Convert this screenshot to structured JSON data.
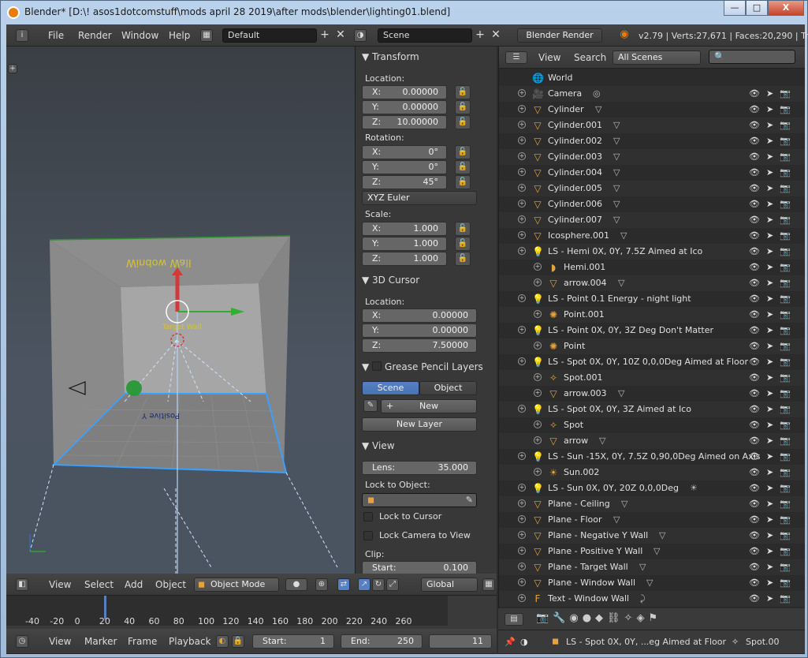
{
  "window": {
    "title": "Blender* [D:\\! asos1dotcomstuff\\mods april 28 2019\\after mods\\blender\\lighting01.blend]",
    "min": "—",
    "max": "□",
    "close": "X"
  },
  "top": {
    "menus": [
      "File",
      "Render",
      "Window",
      "Help"
    ],
    "layout": "Default",
    "scene": "Scene",
    "engine": "Blender Render",
    "stats": "v2.79 | Verts:27,671 | Faces:20,290 | Tris"
  },
  "transform": {
    "title": "Transform",
    "location_label": "Location:",
    "loc": [
      {
        "k": "X:",
        "v": "0.00000"
      },
      {
        "k": "Y:",
        "v": "0.00000"
      },
      {
        "k": "Z:",
        "v": "10.00000"
      }
    ],
    "rotation_label": "Rotation:",
    "rot": [
      {
        "k": "X:",
        "v": "0°"
      },
      {
        "k": "Y:",
        "v": "0°"
      },
      {
        "k": "Z:",
        "v": "45°"
      }
    ],
    "euler": "XYZ Euler",
    "scale_label": "Scale:",
    "scale": [
      {
        "k": "X:",
        "v": "1.000"
      },
      {
        "k": "Y:",
        "v": "1.000"
      },
      {
        "k": "Z:",
        "v": "1.000"
      }
    ]
  },
  "cursor": {
    "title": "3D Cursor",
    "location_label": "Location:",
    "loc": [
      {
        "k": "X:",
        "v": "0.00000"
      },
      {
        "k": "Y:",
        "v": "0.00000"
      },
      {
        "k": "Z:",
        "v": "7.50000"
      }
    ]
  },
  "gpencil": {
    "title": "Grease Pencil Layers",
    "tab_scene": "Scene",
    "tab_object": "Object",
    "new": "New",
    "new_layer": "New Layer"
  },
  "view": {
    "title": "View",
    "lens_label": "Lens:",
    "lens": "35.000",
    "lock_obj": "Lock to Object:",
    "lock_cursor": "Lock to Cursor",
    "lock_camera": "Lock Camera to View",
    "clip": "Clip:",
    "start_label": "Start:",
    "start": "0.100"
  },
  "outliner": {
    "menus": [
      "View",
      "Search"
    ],
    "filter": "All Scenes",
    "rows": [
      {
        "i": "🌐",
        "name": "World",
        "ind": 0,
        "tag": ""
      },
      {
        "i": "🎥",
        "name": "Camera",
        "ind": 0,
        "tag": "◎"
      },
      {
        "i": "▽",
        "name": "Cylinder",
        "ind": 0,
        "tag": "▽"
      },
      {
        "i": "▽",
        "name": "Cylinder.001",
        "ind": 0,
        "tag": "▽"
      },
      {
        "i": "▽",
        "name": "Cylinder.002",
        "ind": 0,
        "tag": "▽"
      },
      {
        "i": "▽",
        "name": "Cylinder.003",
        "ind": 0,
        "tag": "▽"
      },
      {
        "i": "▽",
        "name": "Cylinder.004",
        "ind": 0,
        "tag": "▽"
      },
      {
        "i": "▽",
        "name": "Cylinder.005",
        "ind": 0,
        "tag": "▽"
      },
      {
        "i": "▽",
        "name": "Cylinder.006",
        "ind": 0,
        "tag": "▽"
      },
      {
        "i": "▽",
        "name": "Cylinder.007",
        "ind": 0,
        "tag": "▽"
      },
      {
        "i": "▽",
        "name": "Icosphere.001",
        "ind": 0,
        "tag": "▽"
      },
      {
        "i": "💡",
        "name": "LS - Hemi 0X, 0Y, 7.5Z Aimed at Ico",
        "ind": 0,
        "tag": ""
      },
      {
        "i": "◗",
        "name": "Hemi.001",
        "ind": 1,
        "tag": ""
      },
      {
        "i": "▽",
        "name": "arrow.004",
        "ind": 1,
        "tag": "▽"
      },
      {
        "i": "💡",
        "name": "LS - Point 0.1 Energy - night light",
        "ind": 0,
        "tag": ""
      },
      {
        "i": "✺",
        "name": "Point.001",
        "ind": 1,
        "tag": ""
      },
      {
        "i": "💡",
        "name": "LS - Point 0X, 0Y, 3Z Deg Don't Matter",
        "ind": 0,
        "tag": ""
      },
      {
        "i": "✺",
        "name": "Point",
        "ind": 1,
        "tag": ""
      },
      {
        "i": "💡",
        "name": "LS - Spot 0X, 0Y, 10Z 0,0,0Deg Aimed at Floor",
        "ind": 0,
        "tag": ""
      },
      {
        "i": "✧",
        "name": "Spot.001",
        "ind": 1,
        "tag": ""
      },
      {
        "i": "▽",
        "name": "arrow.003",
        "ind": 1,
        "tag": "▽"
      },
      {
        "i": "💡",
        "name": "LS - Spot 0X, 0Y, 3Z Aimed at Ico",
        "ind": 0,
        "tag": ""
      },
      {
        "i": "✧",
        "name": "Spot",
        "ind": 1,
        "tag": ""
      },
      {
        "i": "▽",
        "name": "arrow",
        "ind": 1,
        "tag": "▽"
      },
      {
        "i": "💡",
        "name": "LS - Sun -15X, 0Y, 7.5Z 0,90,0Deg Aimed on Axis",
        "ind": 0,
        "tag": ""
      },
      {
        "i": "☀",
        "name": "Sun.002",
        "ind": 1,
        "tag": ""
      },
      {
        "i": "💡",
        "name": "LS - Sun 0X, 0Y, 20Z 0,0,0Deg",
        "ind": 0,
        "tag": "☀"
      },
      {
        "i": "▽",
        "name": "Plane - Ceiling",
        "ind": 0,
        "tag": "▽"
      },
      {
        "i": "▽",
        "name": "Plane - Floor",
        "ind": 0,
        "tag": "▽"
      },
      {
        "i": "▽",
        "name": "Plane - Negative Y Wall",
        "ind": 0,
        "tag": "▽"
      },
      {
        "i": "▽",
        "name": "Plane - Positive Y Wall",
        "ind": 0,
        "tag": "▽"
      },
      {
        "i": "▽",
        "name": "Plane - Target Wall",
        "ind": 0,
        "tag": "▽"
      },
      {
        "i": "▽",
        "name": "Plane - Window Wall",
        "ind": 0,
        "tag": "▽"
      },
      {
        "i": "F",
        "name": "Text - Window Wall",
        "ind": 0,
        "tag": "⤸"
      }
    ]
  },
  "viewhdr": {
    "menus": [
      "View",
      "Select",
      "Add",
      "Object"
    ],
    "mode": "Object Mode",
    "orient": "Global"
  },
  "timeline": {
    "ticks": [
      "-40",
      "-20",
      "0",
      "20",
      "40",
      "60",
      "80",
      "100",
      "120",
      "140",
      "160",
      "180",
      "200",
      "220",
      "240",
      "260"
    ],
    "menus": [
      "View",
      "Marker",
      "Frame",
      "Playback"
    ],
    "start_label": "Start:",
    "start": "1",
    "end_label": "End:",
    "end": "250",
    "current": "11"
  },
  "statusbar": {
    "context": "LS - Spot 0X, 0Y, ...eg Aimed at Floor",
    "data": "Spot.00"
  },
  "viewport_text": {
    "wall_label": "Target Wall",
    "floor_label": "Positive Y"
  }
}
